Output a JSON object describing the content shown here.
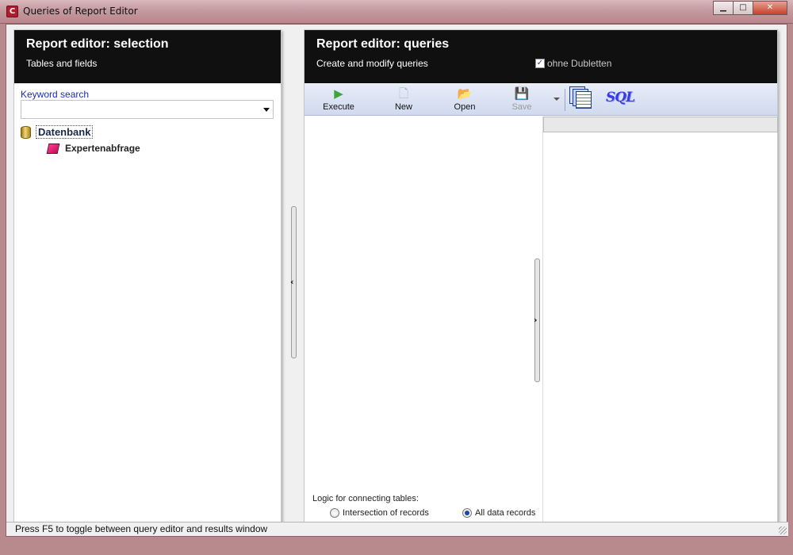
{
  "window": {
    "title": "Queries of Report Editor",
    "app_icon": "C",
    "minimize_glyph": "▁",
    "maximize_glyph": "□",
    "close_glyph": "✕"
  },
  "left_panel": {
    "title": "Report editor: selection",
    "subtitle": "Tables and fields",
    "keyword_label": "Keyword search",
    "keyword_value": "",
    "tree": {
      "root_label": "Datenbank",
      "root_icon": "database-icon",
      "children": [
        {
          "label": "Expertenabfrage",
          "icon": "query-book-icon"
        }
      ]
    }
  },
  "right_panel": {
    "title": "Report editor: queries",
    "subtitle": "Create and modify queries",
    "dedupe_label": "ohne Dubletten",
    "dedupe_checked": true,
    "toolbar": {
      "execute": {
        "label": "Execute",
        "glyph": "▶"
      },
      "new": {
        "label": "New",
        "glyph": "🗋"
      },
      "open": {
        "label": "Open",
        "glyph": "📂"
      },
      "save": {
        "label": "Save",
        "glyph": "💾",
        "enabled": false
      },
      "sql_label": "SQL"
    },
    "logic": {
      "label": "Logic for connecting tables:",
      "options": [
        {
          "label": "Intersection of records",
          "selected": false
        },
        {
          "label": "All data records",
          "selected": true
        }
      ]
    }
  },
  "statusbar": {
    "text": "Press F5 to toggle between query editor and results window"
  },
  "colors": {
    "header_bg": "#101010",
    "keyword_label": "#1a2db8",
    "toolbar_bg": "#d8e1f3",
    "chrome": "#c49aa0"
  }
}
